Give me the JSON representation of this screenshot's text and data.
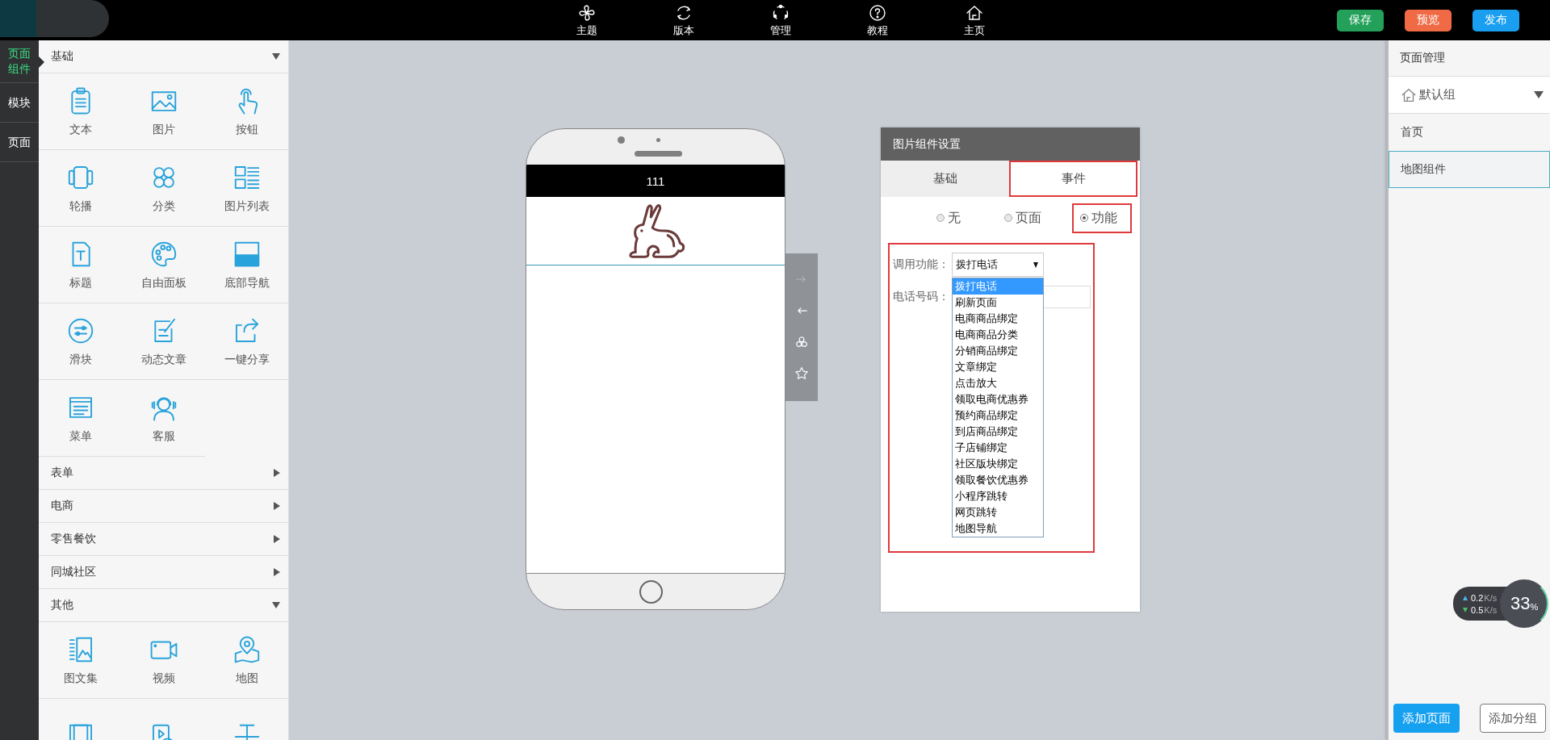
{
  "topbar": {
    "nav": [
      {
        "label": "主题"
      },
      {
        "label": "版本"
      },
      {
        "label": "管理"
      },
      {
        "label": "教程"
      },
      {
        "label": "主页"
      }
    ],
    "actions": [
      {
        "label": "保存",
        "color": "#23a15a"
      },
      {
        "label": "预览",
        "color": "#ef6a45"
      },
      {
        "label": "发布",
        "color": "#1a9ff0"
      }
    ]
  },
  "rail": [
    {
      "label": "页面组件",
      "selected": true
    },
    {
      "label": "模块",
      "selected": false
    },
    {
      "label": "页面",
      "selected": false
    }
  ],
  "library": {
    "sections": [
      {
        "title": "基础",
        "expanded": true,
        "items": [
          "文本",
          "图片",
          "按钮",
          "轮播",
          "分类",
          "图片列表",
          "标题",
          "自由面板",
          "底部导航",
          "滑块",
          "动态文章",
          "一键分享",
          "菜单",
          "客服"
        ]
      },
      {
        "title": "表单",
        "expanded": false
      },
      {
        "title": "电商",
        "expanded": false
      },
      {
        "title": "零售餐饮",
        "expanded": false
      },
      {
        "title": "同城社区",
        "expanded": false
      },
      {
        "title": "其他",
        "expanded": true,
        "items": [
          "图文集",
          "视频",
          "地图"
        ]
      }
    ]
  },
  "phone": {
    "title": "111"
  },
  "settings": {
    "title": "图片组件设置",
    "tabs": [
      {
        "label": "基础",
        "selected": false,
        "annotated": false
      },
      {
        "label": "事件",
        "selected": true,
        "annotated": true
      }
    ],
    "radios": [
      {
        "label": "无",
        "selected": false,
        "annotated": false
      },
      {
        "label": "页面",
        "selected": false,
        "annotated": false
      },
      {
        "label": "功能",
        "selected": true,
        "annotated": true
      }
    ],
    "form": {
      "annotated": true,
      "function_label": "调用功能：",
      "function_value": "拨打电话",
      "phone_label": "电话号码：",
      "options": [
        {
          "label": "拨打电话",
          "selected": true
        },
        {
          "label": "刷新页面",
          "selected": false
        },
        {
          "label": "电商商品绑定",
          "selected": false
        },
        {
          "label": "电商商品分类",
          "selected": false
        },
        {
          "label": "分销商品绑定",
          "selected": false
        },
        {
          "label": "文章绑定",
          "selected": false
        },
        {
          "label": "点击放大",
          "selected": false
        },
        {
          "label": "领取电商优惠券",
          "selected": false
        },
        {
          "label": "预约商品绑定",
          "selected": false
        },
        {
          "label": "到店商品绑定",
          "selected": false
        },
        {
          "label": "子店铺绑定",
          "selected": false
        },
        {
          "label": "社区版块绑定",
          "selected": false
        },
        {
          "label": "领取餐饮优惠券",
          "selected": false
        },
        {
          "label": "小程序跳转",
          "selected": false
        },
        {
          "label": "网页跳转",
          "selected": false
        },
        {
          "label": "地图导航",
          "selected": false
        }
      ]
    }
  },
  "pages": {
    "title": "页面管理",
    "group": "默认组",
    "items": [
      {
        "label": "首页",
        "selected": false
      },
      {
        "label": "地图组件",
        "selected": true
      }
    ],
    "buttons": [
      {
        "label": "添加页面",
        "kind": "primary"
      },
      {
        "label": "添加分组",
        "kind": "outline"
      }
    ]
  },
  "net_widget": {
    "up": "0.2",
    "up_unit": "K/s",
    "down": "0.5",
    "down_unit": "K/s",
    "percent": "33",
    "percent_unit": "%"
  }
}
